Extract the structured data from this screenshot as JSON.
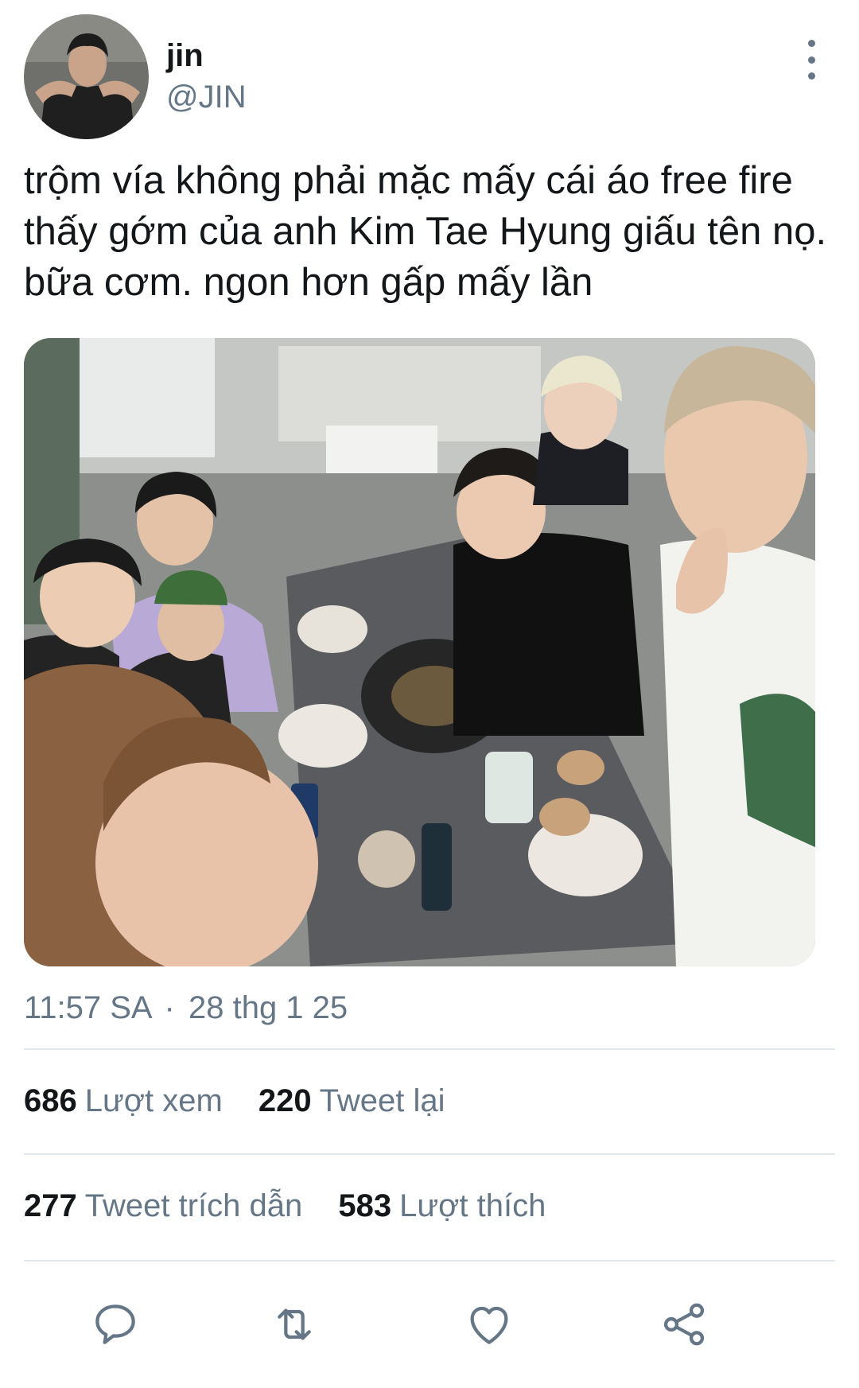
{
  "tweet": {
    "author_name": "jin",
    "author_handle": "@JIN",
    "text": "trộm vía không phải mặc mấy cái áo free fire thấy gớm của anh Kim Tae Hyung giấu tên nọ. bữa cơm. ngon hơn gấp mấy lần",
    "time": "11:57 SA",
    "separator": "·",
    "date": "28 thg 1 25"
  },
  "stats": {
    "views_count": "686",
    "views_label": "Lượt xem",
    "retweets_count": "220",
    "retweets_label": "Tweet lại",
    "quotes_count": "277",
    "quotes_label": "Tweet trích dẫn",
    "likes_count": "583",
    "likes_label": "Lượt thích"
  },
  "actions": [
    "reply-icon",
    "retweet-icon",
    "like-icon",
    "share-icon"
  ],
  "colors": {
    "text": "#14171a",
    "secondary": "#657786",
    "divider": "#e1e8ed"
  }
}
